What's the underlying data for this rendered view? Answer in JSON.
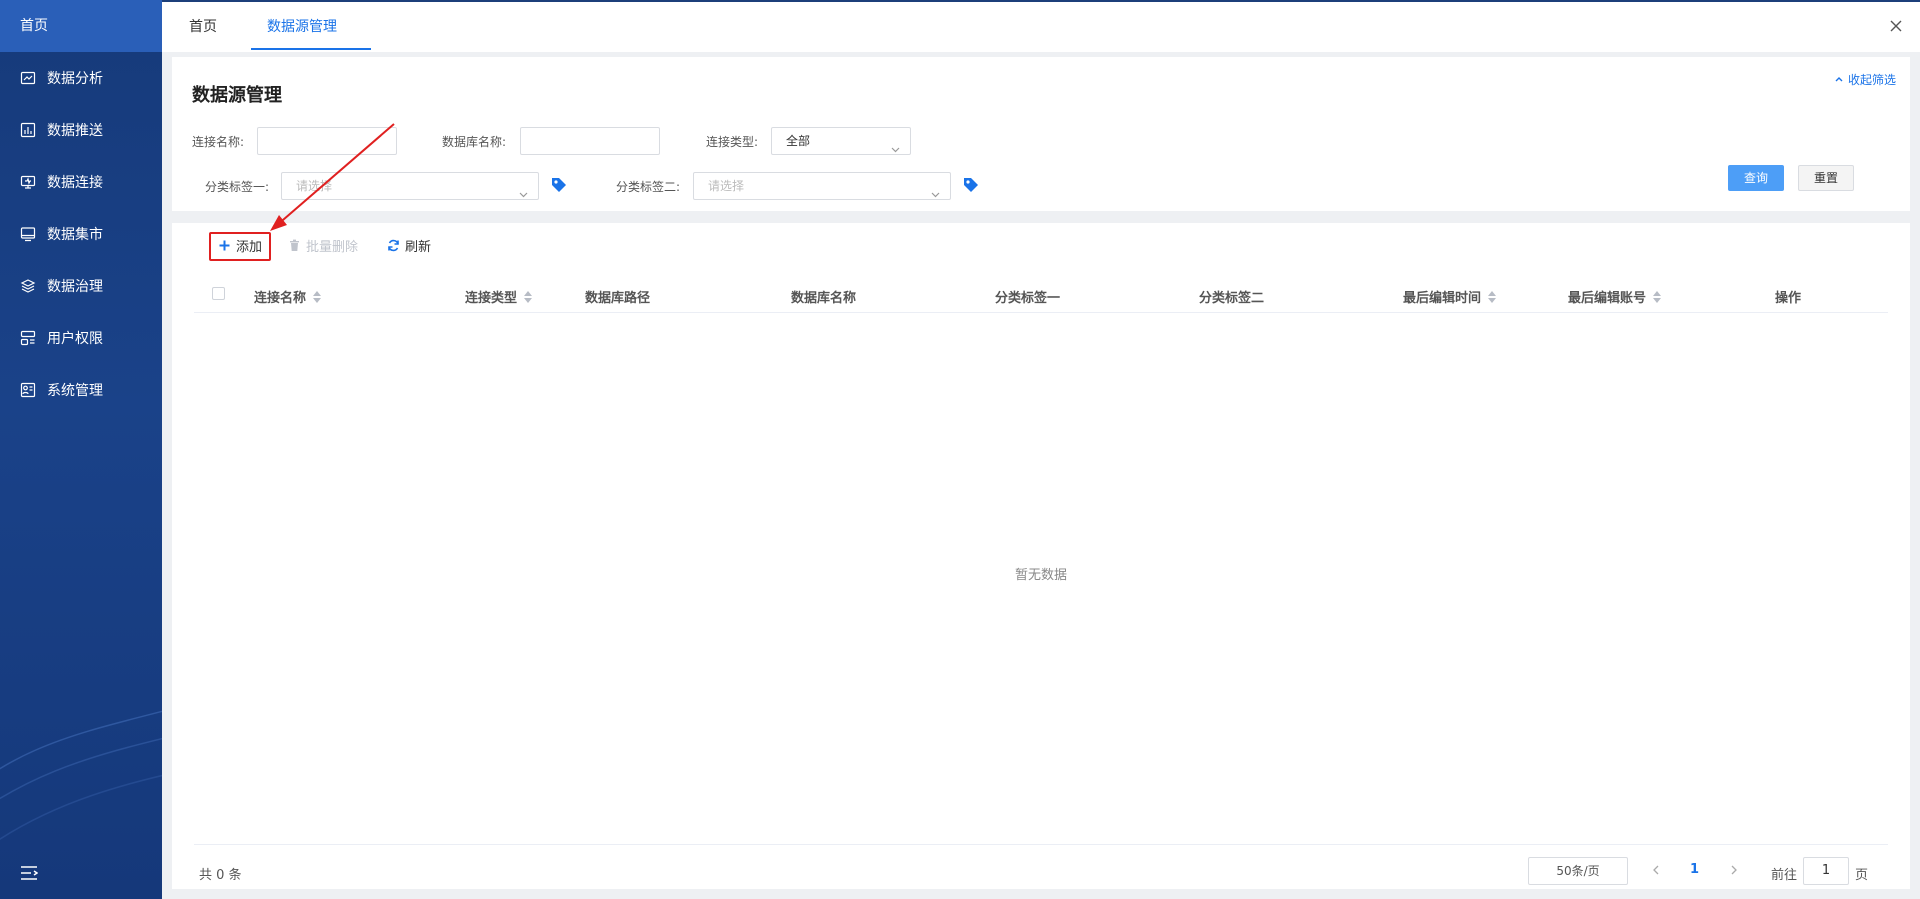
{
  "sidebar": {
    "home_label": "首页",
    "items": [
      {
        "label": "数据分析",
        "icon": "chart-board-icon"
      },
      {
        "label": "数据推送",
        "icon": "bar-chart-icon"
      },
      {
        "label": "数据连接",
        "icon": "connection-icon"
      },
      {
        "label": "数据集市",
        "icon": "monitor-icon"
      },
      {
        "label": "数据治理",
        "icon": "layers-icon"
      },
      {
        "label": "用户权限",
        "icon": "user-rows-icon"
      },
      {
        "label": "系统管理",
        "icon": "system-icon"
      }
    ]
  },
  "tabs": [
    {
      "label": "首页",
      "active": false
    },
    {
      "label": "数据源管理",
      "active": true
    }
  ],
  "page": {
    "title": "数据源管理",
    "collapse_label": "收起筛选"
  },
  "filters": {
    "connection_name_label": "连接名称:",
    "connection_name_value": "",
    "database_name_label": "数据库名称:",
    "database_name_value": "",
    "connection_type_label": "连接类型:",
    "connection_type_value": "全部",
    "tag_one_label": "分类标签一:",
    "tag_one_placeholder": "请选择",
    "tag_two_label": "分类标签二:",
    "tag_two_placeholder": "请选择",
    "query_label": "查询",
    "reset_label": "重置"
  },
  "toolbar": {
    "add_label": "添加",
    "batch_delete_label": "批量删除",
    "refresh_label": "刷新"
  },
  "table": {
    "columns": [
      "连接名称",
      "连接类型",
      "数据库路径",
      "数据库名称",
      "分类标签一",
      "分类标签二",
      "最后编辑时间",
      "最后编辑账号",
      "操作"
    ],
    "rows": [],
    "empty_text": "暂无数据"
  },
  "pagination": {
    "total_text": "共 0 条",
    "page_size": "50条/页",
    "current_page": "1",
    "goto_prefix": "前往",
    "goto_value": "1",
    "goto_suffix": "页"
  },
  "colors": {
    "accent": "#1a73e8",
    "sidebar_bg": "#163a7a",
    "highlight_box": "#e02020"
  }
}
